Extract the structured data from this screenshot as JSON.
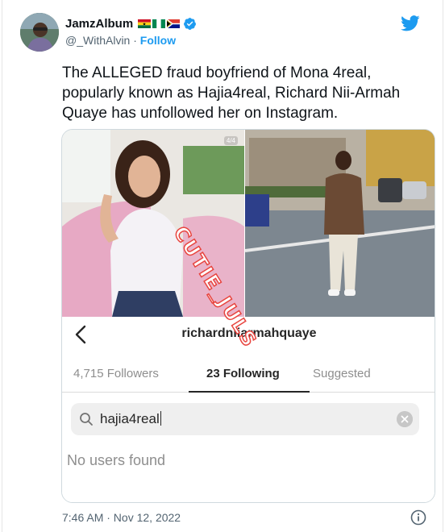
{
  "tweet": {
    "author_name": "JamzAlbum",
    "author_handle": "@_WithAlvin",
    "separator": "·",
    "follow_label": "Follow",
    "flags": [
      "ghana-flag",
      "nigeria-flag",
      "south-africa-flag"
    ],
    "text": "The ALLEGED fraud boyfriend of Mona 4real, popularly known as Hajia4real, Richard Nii-Armah Quaye has unfollowed her on Instagram.",
    "timestamp": "7:46 AM · Nov 12, 2022",
    "icons": [
      "twitter-bird-icon",
      "verified-badge-icon",
      "info-icon"
    ],
    "colors": {
      "accent": "#1d9bf0",
      "text": "#0f1419",
      "secondary": "#536471"
    }
  },
  "media": {
    "photo_counter": "4/4",
    "instagram": {
      "username": "richardniiarmahquaye",
      "tabs": [
        {
          "label": "4,715 Followers"
        },
        {
          "label": "23 Following"
        },
        {
          "label": "Suggested"
        }
      ],
      "active_tab": "23 Following",
      "search_value": "hajia4real",
      "empty_message": "No users found"
    },
    "watermark": "CUTIE_JULS",
    "watermark_color": "#e8453f"
  }
}
